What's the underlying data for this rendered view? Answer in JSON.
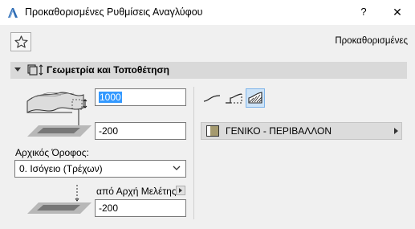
{
  "window": {
    "title": "Προκαθορισμένες Ρυθμίσεις Αναγλύφου",
    "help": "?",
    "close": "✕"
  },
  "toolbar": {
    "favorites_icon": "star-icon",
    "preset_label": "Προκαθορισμένες"
  },
  "section": {
    "title": "Γεωμετρία και Τοποθέτηση",
    "icon": "geometry-icon"
  },
  "geometry": {
    "thickness_value": "1000",
    "offset_value": "-200",
    "home_story_label": "Αρχικός Όροφος:",
    "home_story_value": "0. Ισόγειο (Τρέχων)",
    "reference_label": "από Αρχή Μελέτης",
    "reference_value": "-200"
  },
  "shape": {
    "options": [
      "edge-icon",
      "step-icon",
      "hatched-block-icon"
    ],
    "active_index": 2
  },
  "material": {
    "name": "ΓΕΝΙΚΟ - ΠΕΡΙΒΑΛΛΟΝ",
    "swatch_color": "#a59a6f"
  },
  "colors": {
    "selection": "#3399ff",
    "section_bg": "#d9d9d9",
    "active_button": "#cde3f7"
  }
}
